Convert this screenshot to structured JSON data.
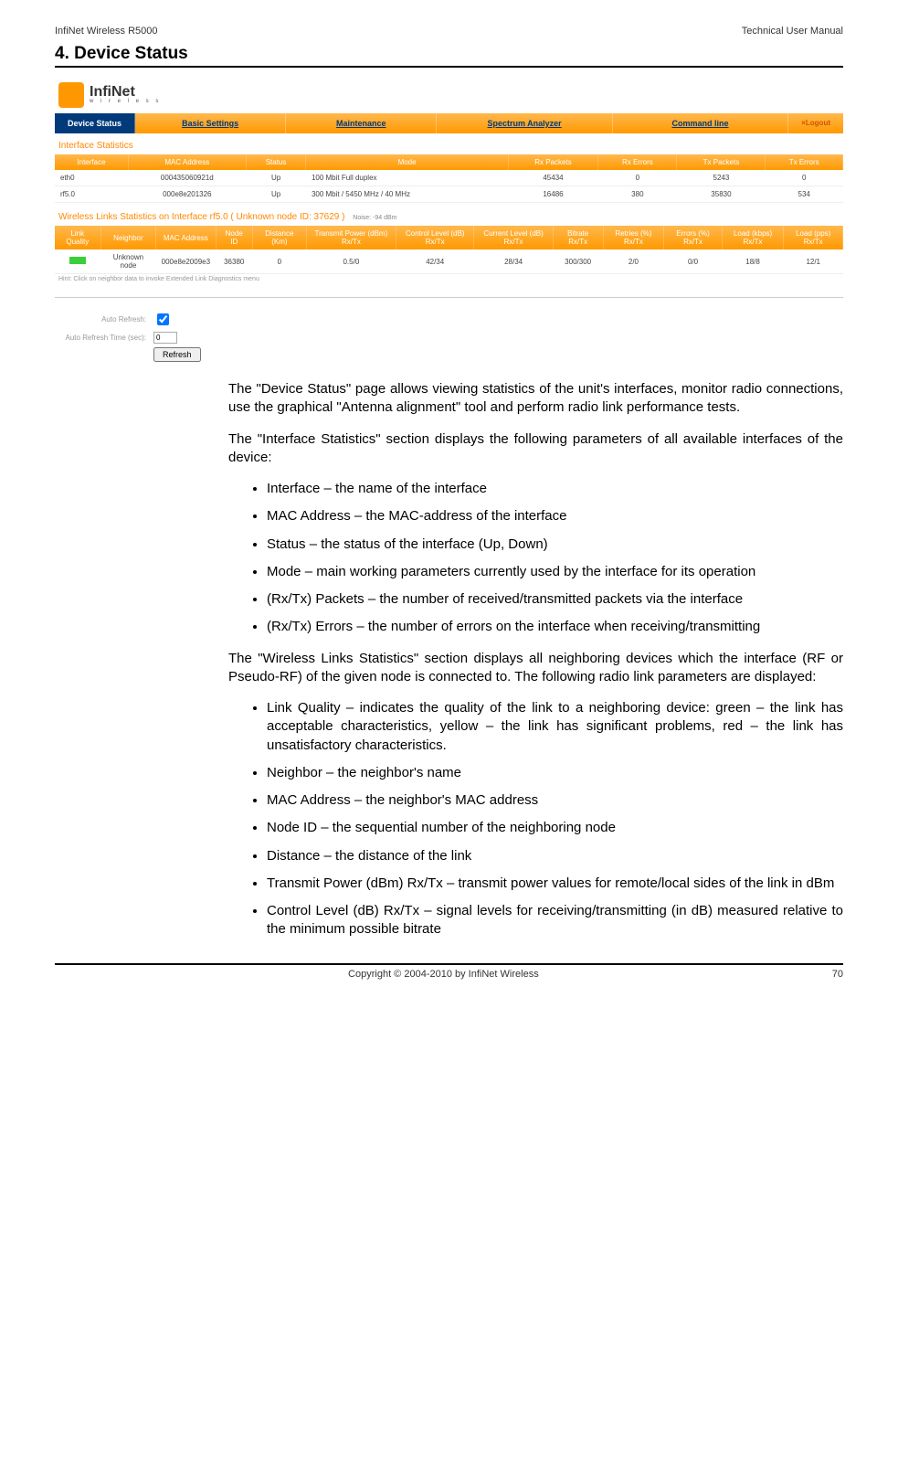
{
  "header": {
    "left": "InfiNet Wireless R5000",
    "right": "Technical User Manual"
  },
  "section_number": "4.",
  "section_title": "Device Status",
  "screenshot": {
    "logo_main": "InfiNet",
    "logo_sub": "w i r e l e s s",
    "tabs": {
      "device_status": "Device Status",
      "basic_settings": "Basic Settings",
      "maintenance": "Maintenance",
      "spectrum": "Spectrum Analyzer",
      "command": "Command line"
    },
    "logout": "×Logout",
    "ifstat_title": "Interface Statistics",
    "ifstat_headers": {
      "interface": "Interface",
      "mac": "MAC Address",
      "status": "Status",
      "mode": "Mode",
      "rxp": "Rx Packets",
      "rxe": "Rx Errors",
      "txp": "Tx Packets",
      "txe": "Tx Errors"
    },
    "ifstat_rows": [
      {
        "interface": "eth0",
        "mac": "000435060921d",
        "status": "Up",
        "mode": "100 Mbit Full duplex",
        "rxp": "45434",
        "rxe": "0",
        "txp": "5243",
        "txe": "0"
      },
      {
        "interface": "rf5.0",
        "mac": "000e8e201326",
        "status": "Up",
        "mode": "300 Mbit / 5450 MHz / 40 MHz",
        "rxp": "16486",
        "rxe": "380",
        "txp": "35830",
        "txe": "534"
      }
    ],
    "wl_title": "Wireless Links Statistics on Interface rf5.0  ( Unknown node ID: 37629 )",
    "wl_noise": "Noise: -94 dBm",
    "wl_headers": {
      "lq": "Link Quality",
      "neighbor": "Neighbor",
      "mac": "MAC Address",
      "node": "Node ID",
      "dist": "Distance (Km)",
      "txpwr": "Transmit Power (dBm) Rx/Tx",
      "ctrl": "Control Level (dB) Rx/Tx",
      "curr": "Current Level (dB) Rx/Tx",
      "bitrate": "Bitrate Rx/Tx",
      "retries": "Retries (%) Rx/Tx",
      "errors": "Errors (%) Rx/Tx",
      "loadk": "Load (kbps) Rx/Tx",
      "loadp": "Load (pps) Rx/Tx"
    },
    "wl_row": {
      "neighbor": "Unknown node",
      "mac": "000e8e2009e3",
      "node": "36380",
      "dist": "0",
      "txpwr": "0.5/0",
      "ctrl": "42/34",
      "curr": "28/34",
      "bitrate": "300/300",
      "retries": "2/0",
      "errors": "0/0",
      "loadk": "18/8",
      "loadp": "12/1"
    },
    "hint": "Hint: Click on neighbor data to invoke Extended Link Diagnostics menu",
    "auto": {
      "label1": "Auto Refresh:",
      "label2": "Auto Refresh Time (sec):",
      "value": "0",
      "button": "Refresh"
    }
  },
  "para1": "The \"Device Status\" page allows viewing statistics of the unit's interfaces, monitor radio connections, use the graphical \"Antenna alignment\" tool and perform radio link performance tests.",
  "para2": "The \"Interface Statistics\" section displays the following parameters of all available interfaces of the device:",
  "list1": [
    "Interface – the name of the interface",
    "MAC Address – the MAC-address of the interface",
    "Status – the status of the interface (Up, Down)",
    "Mode – main working parameters currently used by the interface for its operation",
    "(Rx/Tx) Packets – the number of received/transmitted packets via the interface",
    "(Rx/Tx) Errors – the number of errors on the interface when receiving/transmitting"
  ],
  "para3": "The \"Wireless Links Statistics\" section displays all neighboring devices which the interface (RF or Pseudo-RF) of the given node is connected to. The following radio link parameters are displayed:",
  "list2": [
    "Link Quality – indicates the quality of the link to a neighboring device: green – the link has acceptable characteristics, yellow – the link has significant problems, red – the link has unsatisfactory characteristics.",
    "Neighbor – the neighbor's name",
    "MAC Address – the neighbor's MAC address",
    "Node ID – the sequential number of the neighboring node",
    "Distance – the distance of the link",
    "Transmit Power (dBm) Rx/Tx – transmit power values for remote/local sides of the link in dBm",
    "Control Level (dB) Rx/Tx – signal levels for receiving/transmitting (in dB) measured relative to the minimum possible bitrate"
  ],
  "footer": {
    "copy": "Copyright © 2004-2010 by InfiNet Wireless",
    "page": "70"
  }
}
